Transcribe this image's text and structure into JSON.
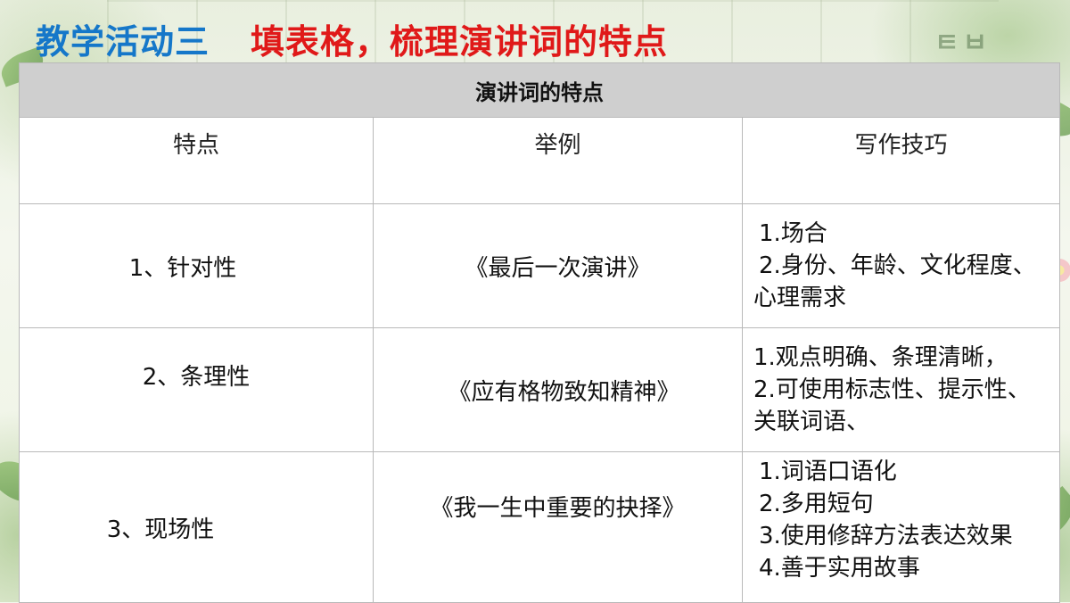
{
  "slide": {
    "title_part1": "教学活动三",
    "title_part2": "填表格，梳理演讲词的特点"
  },
  "table": {
    "caption": "演讲词的特点",
    "headers": [
      "特点",
      "举例",
      "写作技巧"
    ],
    "rows": [
      {
        "feature": "1、针对性",
        "example": "《最后一次演讲》",
        "tips": [
          "1.场合",
          "2.身份、年龄、文化程度、",
          "心理需求"
        ]
      },
      {
        "feature": "2、条理性",
        "example": "《应有格物致知精神》",
        "tips": [
          "1.观点明确、条理清晰，",
          "2.可使用标志性、提示性、",
          "关联词语、"
        ]
      },
      {
        "feature": "3、现场性",
        "example": "《我一生中重要的抉择》",
        "tips": [
          "1.词语口语化",
          "2.多用短句",
          "3.使用修辞方法表达效果",
          "4.善于实用故事"
        ]
      }
    ]
  },
  "colors": {
    "title_blue": "#1577c9",
    "title_red": "#e01919",
    "caption_bg": "#cfcfcf"
  }
}
